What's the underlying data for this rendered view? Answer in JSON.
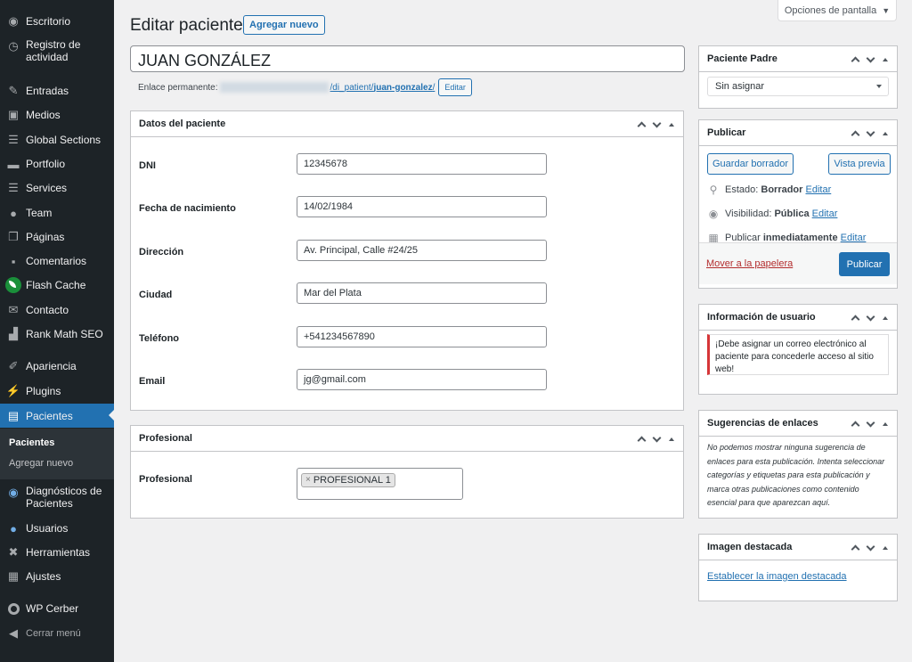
{
  "sidebar": {
    "items": [
      {
        "label": "Escritorio",
        "icon": "dashboard-icon"
      },
      {
        "label": "Registro de actividad",
        "icon": "history-icon"
      },
      {
        "label": "Entradas",
        "icon": "pin-icon"
      },
      {
        "label": "Medios",
        "icon": "media-icon"
      },
      {
        "label": "Global Sections",
        "icon": "list-icon"
      },
      {
        "label": "Portfolio",
        "icon": "folder-icon"
      },
      {
        "label": "Services",
        "icon": "list-icon"
      },
      {
        "label": "Team",
        "icon": "user-icon"
      },
      {
        "label": "Páginas",
        "icon": "pages-icon"
      },
      {
        "label": "Comentarios",
        "icon": "comment-icon"
      },
      {
        "label": "Flash Cache",
        "icon": "leaf-icon"
      },
      {
        "label": "Contacto",
        "icon": "mail-icon"
      },
      {
        "label": "Rank Math SEO",
        "icon": "chart-icon"
      },
      {
        "label": "Apariencia",
        "icon": "brush-icon"
      },
      {
        "label": "Plugins",
        "icon": "plug-icon"
      },
      {
        "label": "Pacientes",
        "icon": "id-card-icon"
      },
      {
        "label": "Diagnósticos de Pacientes",
        "icon": "eye-icon"
      },
      {
        "label": "Usuarios",
        "icon": "users-icon"
      },
      {
        "label": "Herramientas",
        "icon": "wrench-icon"
      },
      {
        "label": "Ajustes",
        "icon": "settings-icon"
      },
      {
        "label": "WP Cerber",
        "icon": "gear-icon"
      },
      {
        "label": "Cerrar menú",
        "icon": "collapse-icon"
      }
    ],
    "submenu": [
      "Pacientes",
      "Agregar nuevo"
    ],
    "colors": {
      "bg": "#1d2327",
      "active": "#2271b1"
    }
  },
  "screen_options": "Opciones de pantalla",
  "header": {
    "title": "Editar paciente",
    "add_new": "Agregar nuevo"
  },
  "post_title": "JUAN GONZÁLEZ",
  "permalink": {
    "label": "Enlace permanente:",
    "path": "/di_patient/",
    "slug": "juan-gonzalez",
    "trailing": "/",
    "edit": "Editar"
  },
  "datos": {
    "title": "Datos del paciente",
    "fields": [
      {
        "label": "DNI",
        "value": "12345678"
      },
      {
        "label": "Fecha de nacimiento",
        "value": "14/02/1984"
      },
      {
        "label": "Dirección",
        "value": "Av. Principal, Calle #24/25"
      },
      {
        "label": "Ciudad",
        "value": "Mar del Plata"
      },
      {
        "label": "Teléfono",
        "value": "+541234567890"
      },
      {
        "label": "Email",
        "value": "jg@gmail.com"
      }
    ]
  },
  "profesional": {
    "title": "Profesional",
    "label": "Profesional",
    "token": "PROFESIONAL 1",
    "remove": "×"
  },
  "parent": {
    "title": "Paciente Padre",
    "selected": "Sin asignar"
  },
  "publish": {
    "title": "Publicar",
    "save_draft": "Guardar borrador",
    "preview": "Vista previa",
    "status_label": "Estado:",
    "status_value": "Borrador",
    "visibility_label": "Visibilidad:",
    "visibility_value": "Pública",
    "publish_label": "Publicar",
    "publish_value": "inmediatamente",
    "edit": "Editar",
    "trash": "Mover a la papelera",
    "publish_button": "Publicar"
  },
  "user_info": {
    "title": "Información de usuario",
    "notice": "¡Debe asignar un correo electrónico al paciente para concederle acceso al sitio web!"
  },
  "link_suggestions": {
    "title": "Sugerencias de enlaces",
    "text": "No podemos mostrar ninguna sugerencia de enlaces para esta publicación. Intenta seleccionar categorías y etiquetas para esta publicación y marca otras publicaciones como contenido esencial para que aparezcan aquí."
  },
  "featured": {
    "title": "Imagen destacada",
    "link": "Establecer la imagen destacada"
  }
}
